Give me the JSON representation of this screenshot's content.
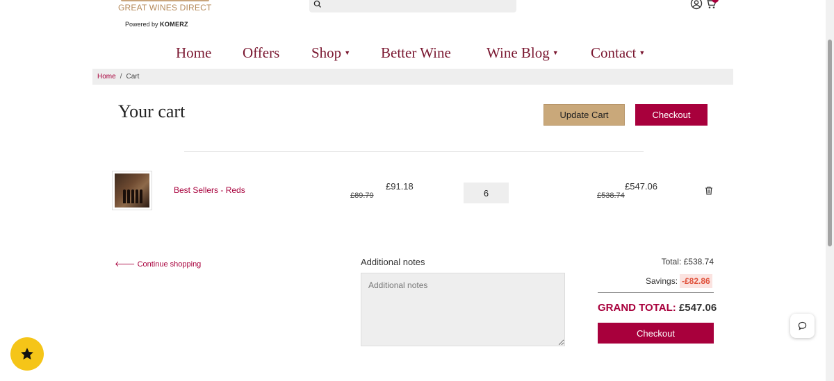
{
  "header": {
    "logo_text": "GREAT WINES DIRECT",
    "powered_prefix": "Powered by",
    "powered_brand": "KOMERZ"
  },
  "nav": {
    "items": [
      {
        "label": "Home"
      },
      {
        "label": "Offers"
      },
      {
        "label": "Shop"
      },
      {
        "label": "Better Wine"
      },
      {
        "label": "Wine Blog"
      },
      {
        "label": "Contact"
      }
    ]
  },
  "breadcrumb": {
    "home": "Home",
    "separator": "/",
    "current": "Cart"
  },
  "cart": {
    "title": "Your cart",
    "update_label": "Update Cart",
    "checkout_label": "Checkout",
    "items": [
      {
        "name": "Best Sellers - Reds",
        "price": "£91.18",
        "compare_price": "£89.79",
        "quantity": "6",
        "line_total": "£547.06",
        "compare_line_total": "£538.74"
      }
    ]
  },
  "footer": {
    "continue_label": "Continue shopping",
    "notes_label": "Additional notes",
    "notes_placeholder": "Additional notes",
    "total_label": "Total: £538.74",
    "savings_label": "Savings:",
    "savings_value": "-£82.86",
    "grand_total_label": "GRAND TOTAL:",
    "grand_total_value": "£547.06",
    "checkout_label": "Checkout"
  },
  "colors": {
    "brand": "#a8003c",
    "nav_text": "#7a1730",
    "update_button": "#c9a87a",
    "savings_bg": "#fbe3e0",
    "savings_text": "#e0533d",
    "floating_button": "#f5c518"
  },
  "icons": {
    "search": "search-icon",
    "user": "user-icon",
    "cart": "cart-icon",
    "trash": "trash-icon",
    "back_arrow": "arrow-left-icon",
    "favorite": "star-icon",
    "chat": "chat-icon"
  }
}
